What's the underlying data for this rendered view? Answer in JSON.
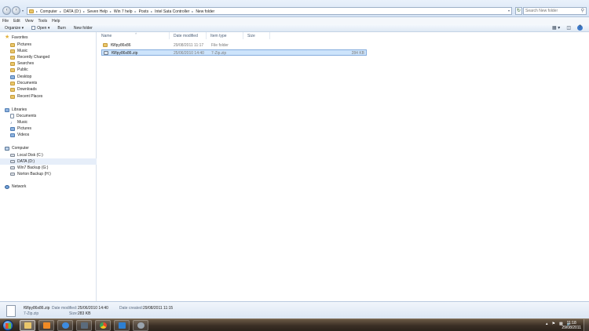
{
  "address_bar": {
    "crumbs": [
      "Computer",
      "DATA (D:)",
      "Seven Help",
      "Win 7 help",
      "Posts",
      "Intel Sata Controller",
      "New folder"
    ],
    "search_placeholder": "Search New folder"
  },
  "menu": [
    "File",
    "Edit",
    "View",
    "Tools",
    "Help"
  ],
  "commands": {
    "organize": "Organize",
    "open": "Open",
    "burn": "Burn",
    "new_folder": "New folder"
  },
  "nav": {
    "favorites_header": "Favorites",
    "favorites": [
      "Pictures",
      "Music",
      "Recently Changed",
      "Searches",
      "Public",
      "Desktop",
      "Documents",
      "Downloads",
      "Recent Places"
    ],
    "libraries_header": "Libraries",
    "libraries": [
      "Documents",
      "Music",
      "Pictures",
      "Videos"
    ],
    "computer_header": "Computer",
    "drives": [
      "Local Disk (C:)",
      "DATA (D:)",
      "Win7 Backup (G:)",
      "Norton Backup (H:)"
    ],
    "network": "Network"
  },
  "columns": {
    "name": "Name",
    "date_modified": "Date modified",
    "item_type": "Item type",
    "size": "Size"
  },
  "files": [
    {
      "name": "f6flpy86x86",
      "date": "29/08/2011 11:17",
      "type": "File folder",
      "size": ""
    },
    {
      "name": "f6flpy86x86.zip",
      "date": "25/06/2010 14:40",
      "type": "7-Zip.zip",
      "size": "284 KB"
    }
  ],
  "details": {
    "filename": "f6flpy86x86.zip",
    "filetype": "7-Zip.zip",
    "date_modified_label": "Date modified:",
    "date_modified": "25/06/2010 14:40",
    "size_label": "Size:",
    "size": "283 KB",
    "date_created_label": "Date created:",
    "date_created": "29/08/2011 11:15"
  },
  "taskbar": {
    "time": "11:18",
    "date": "29/08/2011"
  }
}
